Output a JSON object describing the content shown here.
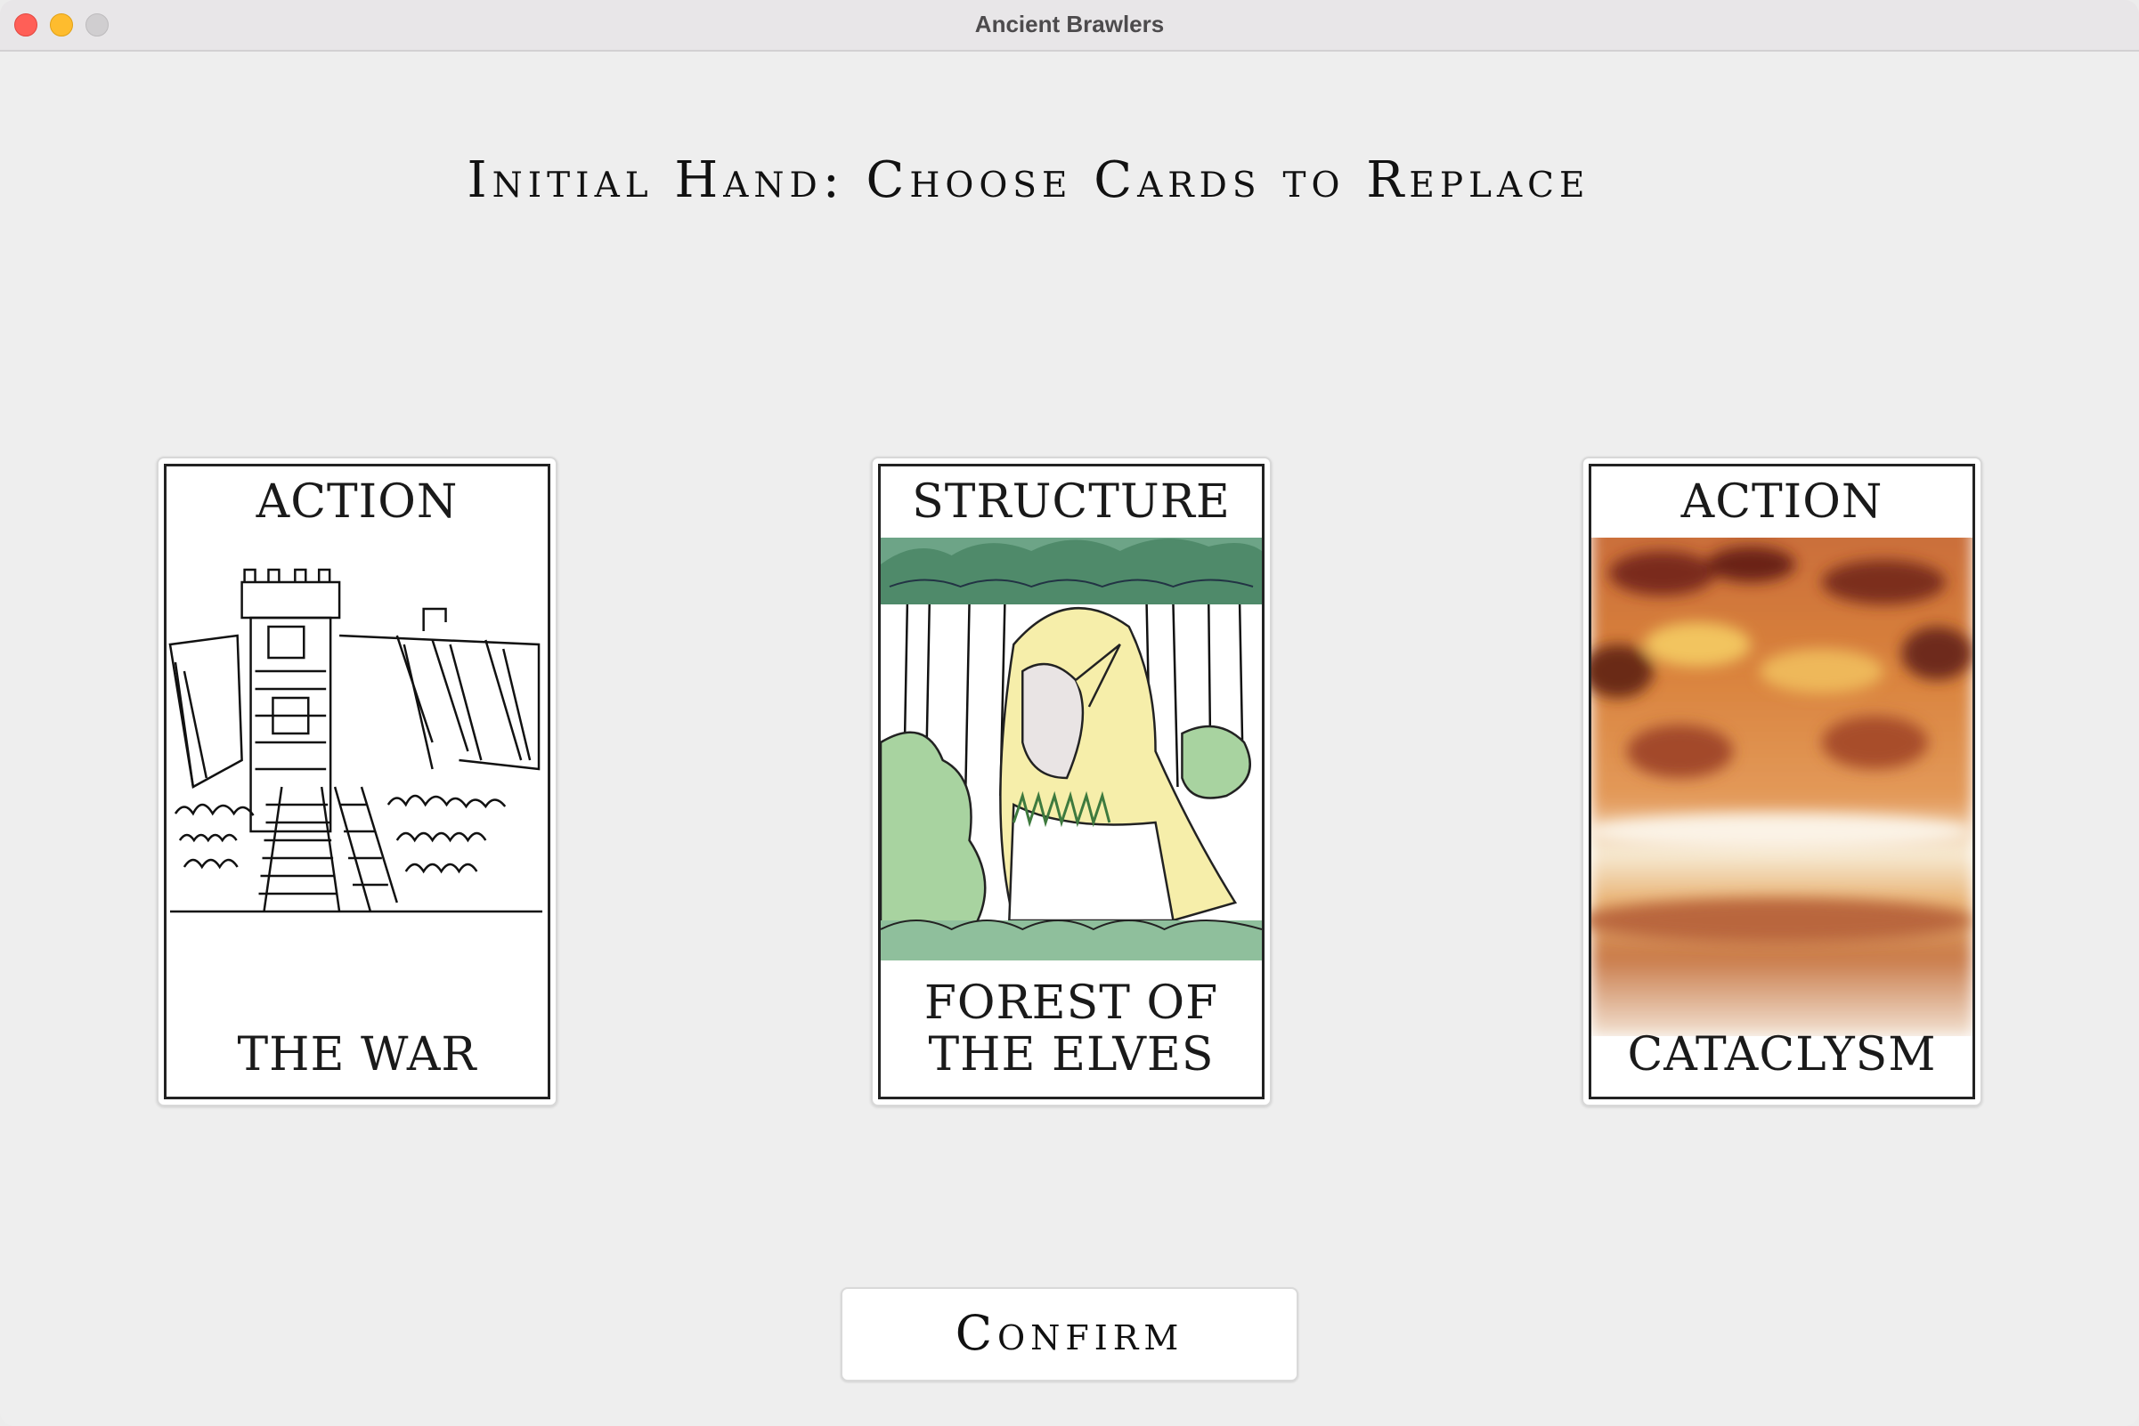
{
  "window": {
    "title": "Ancient Brawlers"
  },
  "main": {
    "heading": "Initial Hand: Choose Cards to Replace",
    "confirm_label": "Confirm"
  },
  "cards": [
    {
      "type": "ACTION",
      "name": "THE WAR",
      "art": "war-siege-sketch"
    },
    {
      "type": "STRUCTURE",
      "name_line1": "FOREST OF",
      "name_line2": "THE ELVES",
      "art": "elf-forest-drawing"
    },
    {
      "type": "ACTION",
      "name": "CATACLYSM",
      "art": "fiery-cataclysm-painting"
    }
  ]
}
